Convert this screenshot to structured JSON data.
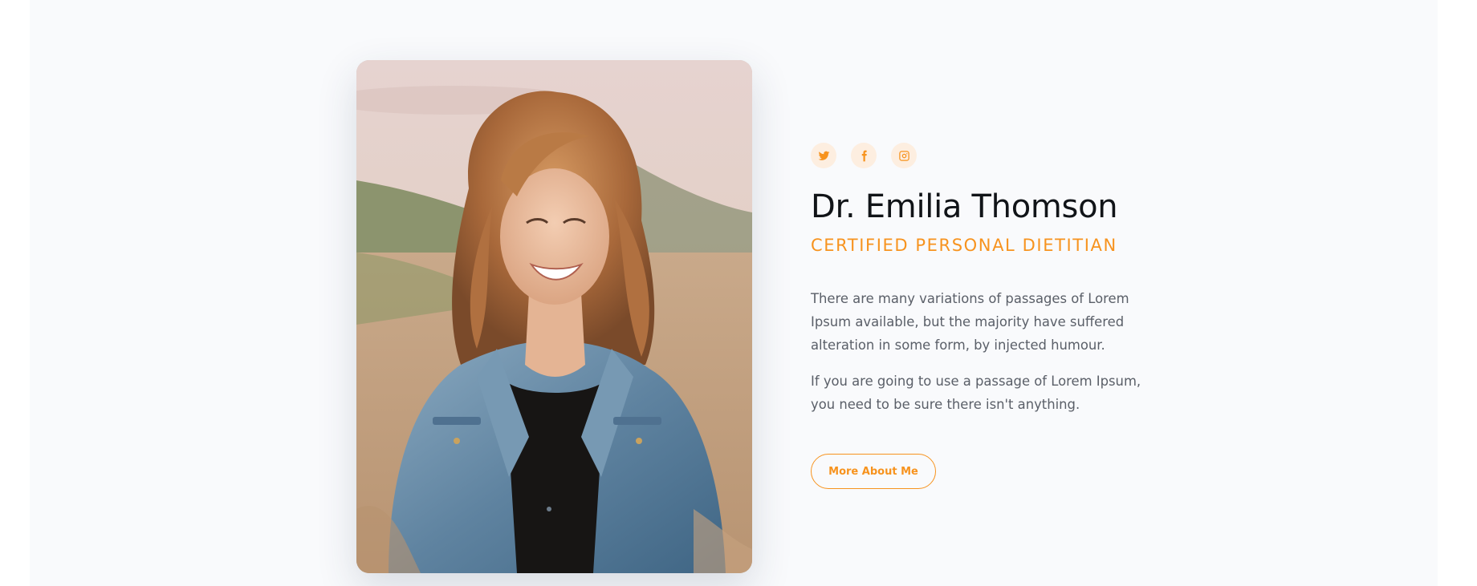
{
  "profile": {
    "name": "Dr. Emilia Thomson",
    "role": "CERTIFIED PERSONAL DIETITIAN",
    "bio_paragraph_1": "There are many variations of passages of Lorem Ipsum available, but the majority have suffered alteration in some form, by injected humour.",
    "bio_paragraph_2": "If you are going to use a passage of Lorem Ipsum, you need to be sure there isn't anything.",
    "cta_label": "More About Me"
  },
  "social": [
    {
      "icon": "twitter-icon"
    },
    {
      "icon": "facebook-icon"
    },
    {
      "icon": "instagram-icon"
    }
  ],
  "colors": {
    "accent": "#f7931e",
    "icon_bg": "#fdeee0",
    "heading": "#111418",
    "body_text": "#5a5f68",
    "section_bg": "#f9fafc"
  }
}
